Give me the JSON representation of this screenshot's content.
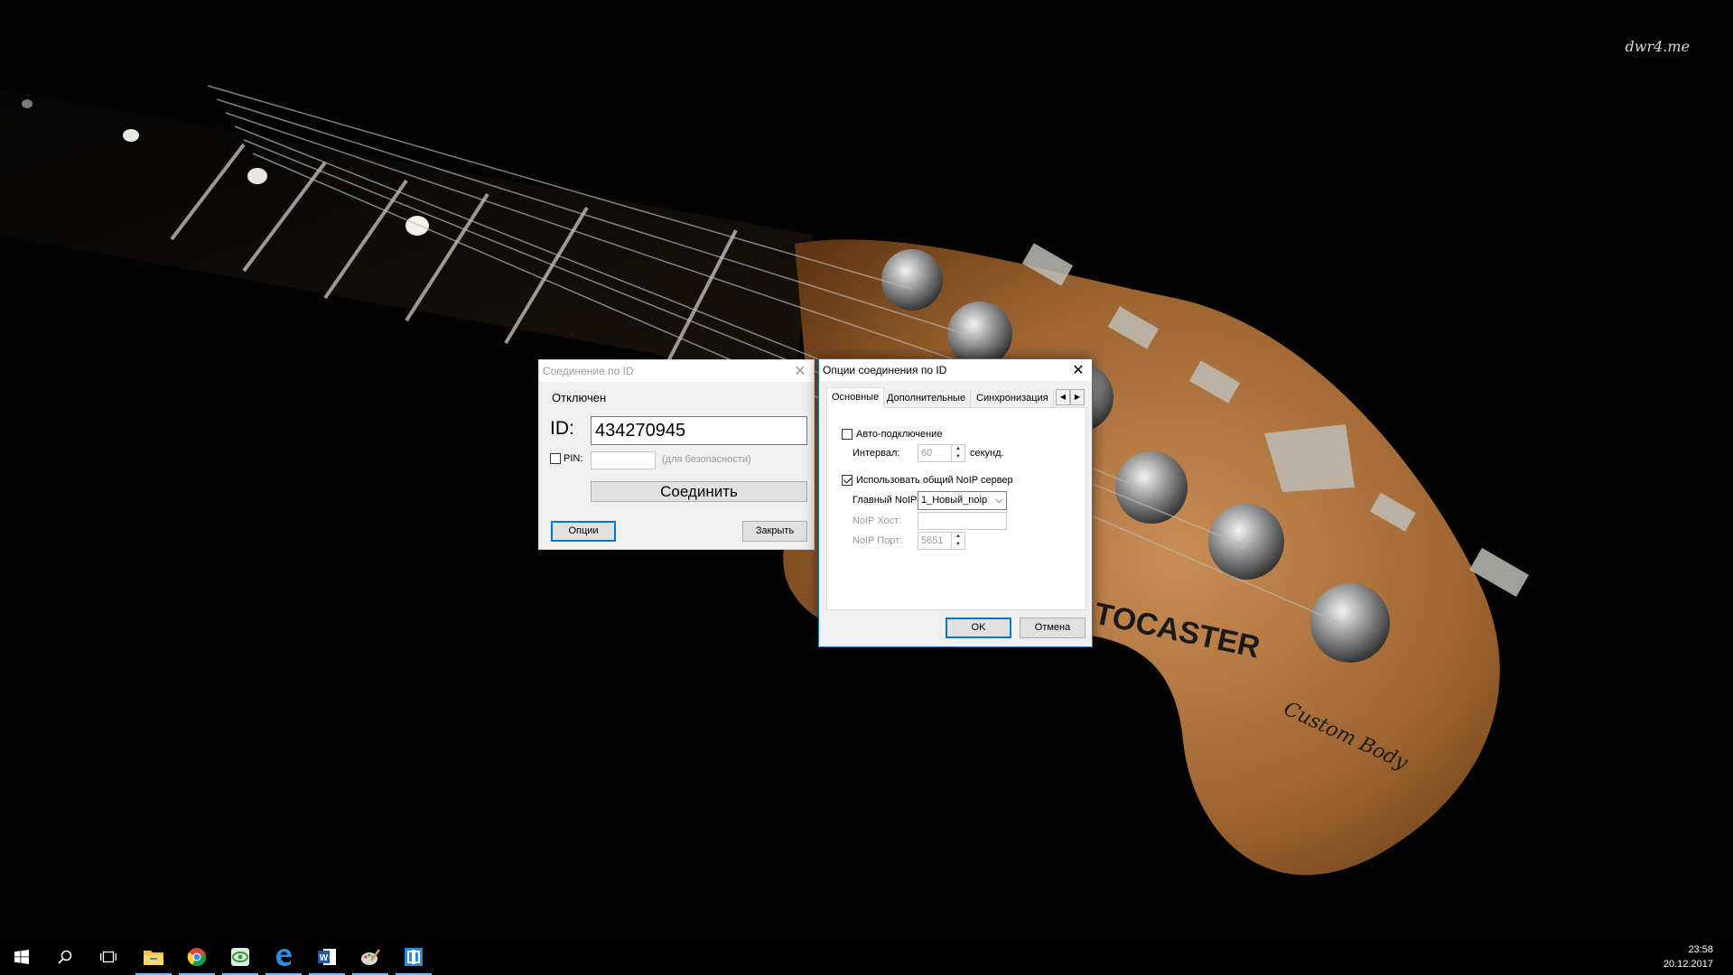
{
  "watermark": "dwr4.me",
  "connect_dialog": {
    "title": "Соединение по ID",
    "status": "Отключен",
    "id_label": "ID:",
    "id_value": "434270945",
    "pin_label": "PIN:",
    "pin_value": "",
    "pin_hint": "(для безопасности)",
    "connect_button": "Соединить",
    "options_button": "Опции",
    "close_button": "Закрыть"
  },
  "options_dialog": {
    "title": "Опции соединения по ID",
    "tabs": [
      {
        "label": "Основные",
        "active": true
      },
      {
        "label": "Дополнительные",
        "active": false
      },
      {
        "label": "Синхронизация",
        "active": false
      }
    ],
    "auto_connect": {
      "label": "Авто-подключение",
      "checked": false
    },
    "interval": {
      "label": "Интервал:",
      "value": "60",
      "unit": "секунд."
    },
    "use_noip": {
      "label": "Использовать общий NoIP сервер",
      "checked": true
    },
    "main_noip": {
      "label": "Главный NoIP:",
      "value": "1_Новый_noip"
    },
    "noip_host": {
      "label": "NoIP Хост:",
      "value": ""
    },
    "noip_port": {
      "label": "NoIP Порт:",
      "value": "5651"
    },
    "ok_button": "OK",
    "cancel_button": "Отмена"
  },
  "taskbar": {
    "items": [
      {
        "icon": "windows-start-icon"
      },
      {
        "icon": "search-icon"
      },
      {
        "icon": "task-view-icon"
      },
      {
        "icon": "file-explorer-icon",
        "running": true
      },
      {
        "icon": "chrome-icon",
        "running": true
      },
      {
        "icon": "green-app-icon",
        "running": true
      },
      {
        "icon": "edge-icon",
        "running": true
      },
      {
        "icon": "word-icon",
        "running": true
      },
      {
        "icon": "paint-icon",
        "running": true
      },
      {
        "icon": "remote-access-icon",
        "running": true
      }
    ],
    "time": "23:58",
    "date": "20.12.2017"
  }
}
